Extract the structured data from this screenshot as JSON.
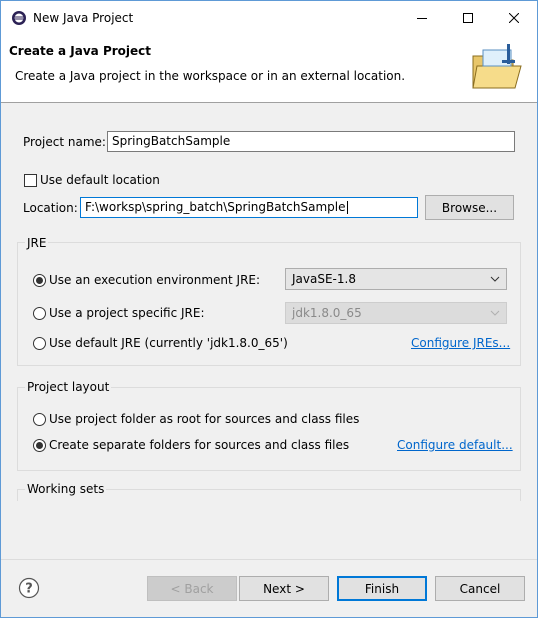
{
  "window": {
    "title": "New Java Project"
  },
  "header": {
    "title": "Create a Java Project",
    "description": "Create a Java project in the workspace or in an external location."
  },
  "project": {
    "name_label": "Project name:",
    "name_value": "SpringBatchSample",
    "default_location_label": "Use default location",
    "default_location_checked": false,
    "location_label": "Location:",
    "location_value": "F:\\worksp\\spring_batch\\SpringBatchSample",
    "browse_label": "Browse..."
  },
  "jre": {
    "group_title": "JRE",
    "option_env_label": "Use an execution environment JRE:",
    "option_env_value": "JavaSE-1.8",
    "option_specific_label": "Use a project specific JRE:",
    "option_specific_value": "jdk1.8.0_65",
    "option_default_label": "Use default JRE (currently 'jdk1.8.0_65')",
    "configure_link": "Configure JREs...",
    "selected": "env"
  },
  "layout": {
    "group_title": "Project layout",
    "option_root_label": "Use project folder as root for sources and class files",
    "option_separate_label": "Create separate folders for sources and class files",
    "configure_link": "Configure default...",
    "selected": "separate"
  },
  "working_sets": {
    "group_title": "Working sets"
  },
  "footer": {
    "back_label": "< Back",
    "next_label": "Next >",
    "finish_label": "Finish",
    "cancel_label": "Cancel"
  },
  "colors": {
    "link": "#0066cc",
    "accent": "#0078d7"
  }
}
